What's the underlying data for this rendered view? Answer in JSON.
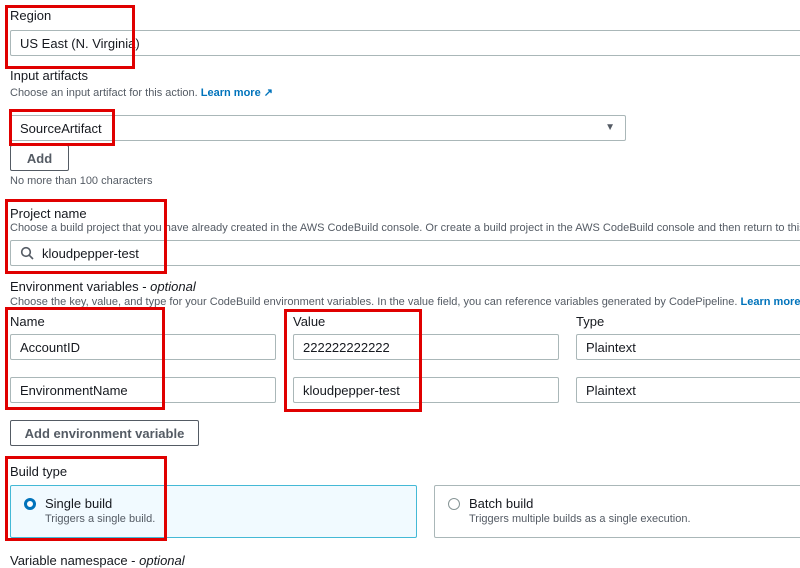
{
  "region": {
    "label": "Region",
    "value": "US East (N. Virginia)"
  },
  "input_artifacts": {
    "label": "Input artifacts",
    "description": "Choose an input artifact for this action.",
    "learn_more": "Learn more",
    "value": "SourceArtifact",
    "add_label": "Add",
    "constraint": "No more than 100 characters"
  },
  "project": {
    "label": "Project name",
    "description": "Choose a build project that you have already created in the AWS CodeBuild console. Or create a build project in the AWS CodeBuild console and then return to this task.",
    "value": "kloudpepper-test"
  },
  "env_vars": {
    "label": "Environment variables - ",
    "optional": "optional",
    "description": "Choose the key, value, and type for your CodeBuild environment variables. In the value field, you can reference variables generated by CodePipeline.",
    "learn_more": "Learn more",
    "headers": {
      "name": "Name",
      "value": "Value",
      "type": "Type"
    },
    "rows": [
      {
        "name": "AccountID",
        "value": "222222222222",
        "type": "Plaintext"
      },
      {
        "name": "EnvironmentName",
        "value": "kloudpepper-test",
        "type": "Plaintext"
      }
    ],
    "add_label": "Add environment variable"
  },
  "build_type": {
    "label": "Build type",
    "options": [
      {
        "title": "Single build",
        "description": "Triggers a single build.",
        "selected": true
      },
      {
        "title": "Batch build",
        "description": "Triggers multiple builds as a single execution.",
        "selected": false
      }
    ]
  },
  "variable_namespace": {
    "label": "Variable namespace - ",
    "optional": "optional"
  },
  "colors": {
    "accent": "#0073bb",
    "highlight": "#e00000",
    "selected_bg": "#f1faff"
  }
}
